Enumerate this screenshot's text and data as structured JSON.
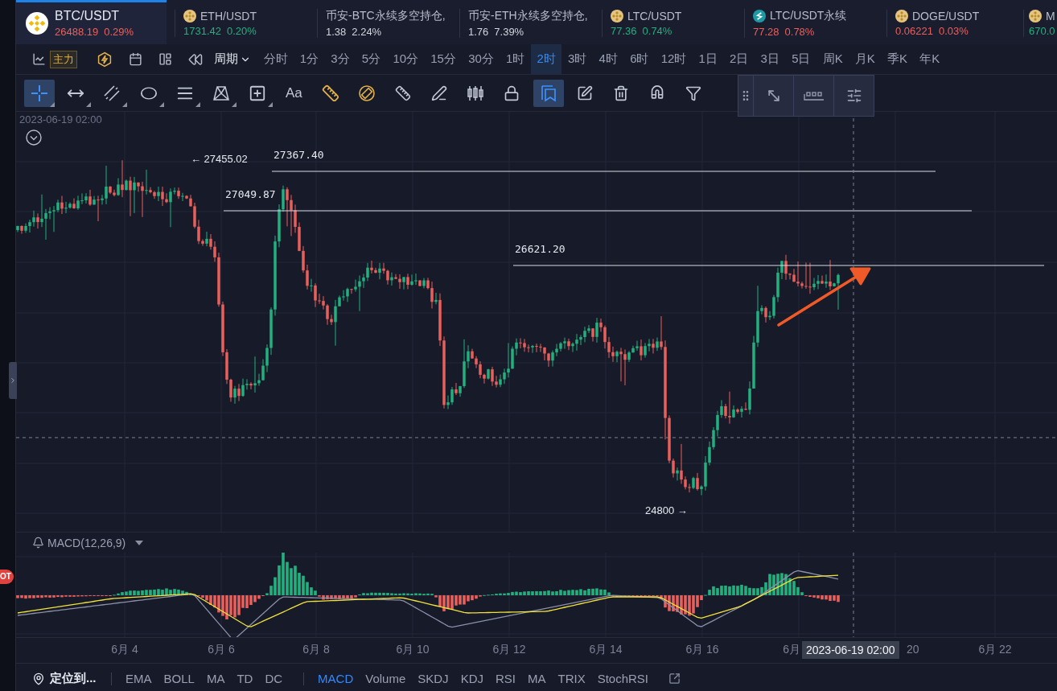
{
  "tickers": [
    {
      "name": "BTC/USDT",
      "price": "26488.19",
      "change": "0.29%",
      "color": "#e8605c",
      "selected": true
    },
    {
      "name": "ETH/USDT",
      "price": "1731.42",
      "change": "0.20%",
      "color": "#22b07f",
      "selected": false
    },
    {
      "name": "币安-BTC永续多空持仓,",
      "price": "1.38",
      "change": "2.24%",
      "color": "#d0d4de",
      "selected": false
    },
    {
      "name": "币安-ETH永续多空持仓,",
      "price": "1.76",
      "change": "7.39%",
      "color": "#d0d4de",
      "selected": false
    },
    {
      "name": "LTC/USDT",
      "price": "77.36",
      "change": "0.74%",
      "color": "#22b07f",
      "selected": false
    },
    {
      "name": "LTC/USDT永续",
      "price": "77.28",
      "change": "0.78%",
      "color": "#e8605c",
      "selected": false
    },
    {
      "name": "DOGE/USDT",
      "price": "0.06221",
      "change": "0.03%",
      "color": "#e8605c",
      "selected": false
    },
    {
      "name": "M",
      "price": "670.0",
      "color": "#22b07f",
      "selected": false
    }
  ],
  "period_bar": {
    "main_badge": "主力",
    "period_menu": "周期",
    "periods": [
      {
        "label": "分时",
        "selected": false
      },
      {
        "label": "1分",
        "selected": false
      },
      {
        "label": "3分",
        "selected": false
      },
      {
        "label": "5分",
        "selected": false
      },
      {
        "label": "10分",
        "selected": false
      },
      {
        "label": "15分",
        "selected": false
      },
      {
        "label": "30分",
        "selected": false
      },
      {
        "label": "1时",
        "selected": false
      },
      {
        "label": "2时",
        "selected": true
      },
      {
        "label": "3时",
        "selected": false
      },
      {
        "label": "4时",
        "selected": false
      },
      {
        "label": "6时",
        "selected": false
      },
      {
        "label": "12时",
        "selected": false
      },
      {
        "label": "1日",
        "selected": false
      },
      {
        "label": "2日",
        "selected": false
      },
      {
        "label": "3日",
        "selected": false
      },
      {
        "label": "5日",
        "selected": false
      },
      {
        "label": "周K",
        "selected": false
      },
      {
        "label": "月K",
        "selected": false
      },
      {
        "label": "季K",
        "selected": false
      },
      {
        "label": "年K",
        "selected": false
      }
    ]
  },
  "tools": [
    {
      "kind": "icon",
      "selected": true
    },
    {
      "kind": "icon",
      "selected": false
    },
    {
      "kind": "icon",
      "selected": false
    },
    {
      "kind": "icon",
      "selected": false
    },
    {
      "kind": "icon",
      "selected": false
    },
    {
      "kind": "icon",
      "selected": false
    },
    {
      "kind": "icon",
      "selected": false
    },
    {
      "kind": "text",
      "label": "Aa",
      "selected": false
    },
    {
      "kind": "icon",
      "selected": false
    },
    {
      "kind": "icon",
      "selected": false
    },
    {
      "kind": "icon",
      "selected": false
    },
    {
      "kind": "icon",
      "selected": false
    },
    {
      "kind": "icon",
      "selected": false
    },
    {
      "kind": "icon",
      "selected": false
    },
    {
      "kind": "icon",
      "selected": true
    },
    {
      "kind": "icon",
      "selected": false
    },
    {
      "kind": "icon",
      "selected": false
    },
    {
      "kind": "icon",
      "selected": false
    },
    {
      "kind": "icon",
      "selected": false
    }
  ],
  "chart": {
    "cursor_time": "2023-06-19 02:00",
    "price_levels": [
      {
        "label": "27367.40"
      },
      {
        "label": "27049.87"
      },
      {
        "label": "26621.20"
      }
    ],
    "markers": [
      {
        "label": "← 27455.02"
      },
      {
        "label": "24800 →"
      }
    ]
  },
  "macd": {
    "title": "MACD(12,26,9)"
  },
  "x_axis": {
    "labels": [
      {
        "text": "6月 4"
      },
      {
        "text": "6月 6"
      },
      {
        "text": "6月 8"
      },
      {
        "text": "6月 10"
      },
      {
        "text": "6月 12"
      },
      {
        "text": "6月 14"
      },
      {
        "text": "6月 16"
      },
      {
        "text": "6月"
      },
      {
        "text": "20"
      },
      {
        "text": "6月 22"
      }
    ],
    "tooltip": "2023-06-19 02:00"
  },
  "side": {
    "badge": "OT"
  },
  "bottom_bar": {
    "locate": "定位到...",
    "main_indicators": [
      {
        "label": "EMA",
        "selected": false
      },
      {
        "label": "BOLL",
        "selected": false
      },
      {
        "label": "MA",
        "selected": false
      },
      {
        "label": "TD",
        "selected": false
      },
      {
        "label": "DC",
        "selected": false
      }
    ],
    "sub_indicators": [
      {
        "label": "MACD",
        "selected": true
      },
      {
        "label": "Volume",
        "selected": false
      },
      {
        "label": "SKDJ",
        "selected": false
      },
      {
        "label": "KDJ",
        "selected": false
      },
      {
        "label": "RSI",
        "selected": false
      },
      {
        "label": "MA",
        "selected": false
      },
      {
        "label": "TRIX",
        "selected": false
      },
      {
        "label": "StochRSI",
        "selected": false
      }
    ]
  }
}
